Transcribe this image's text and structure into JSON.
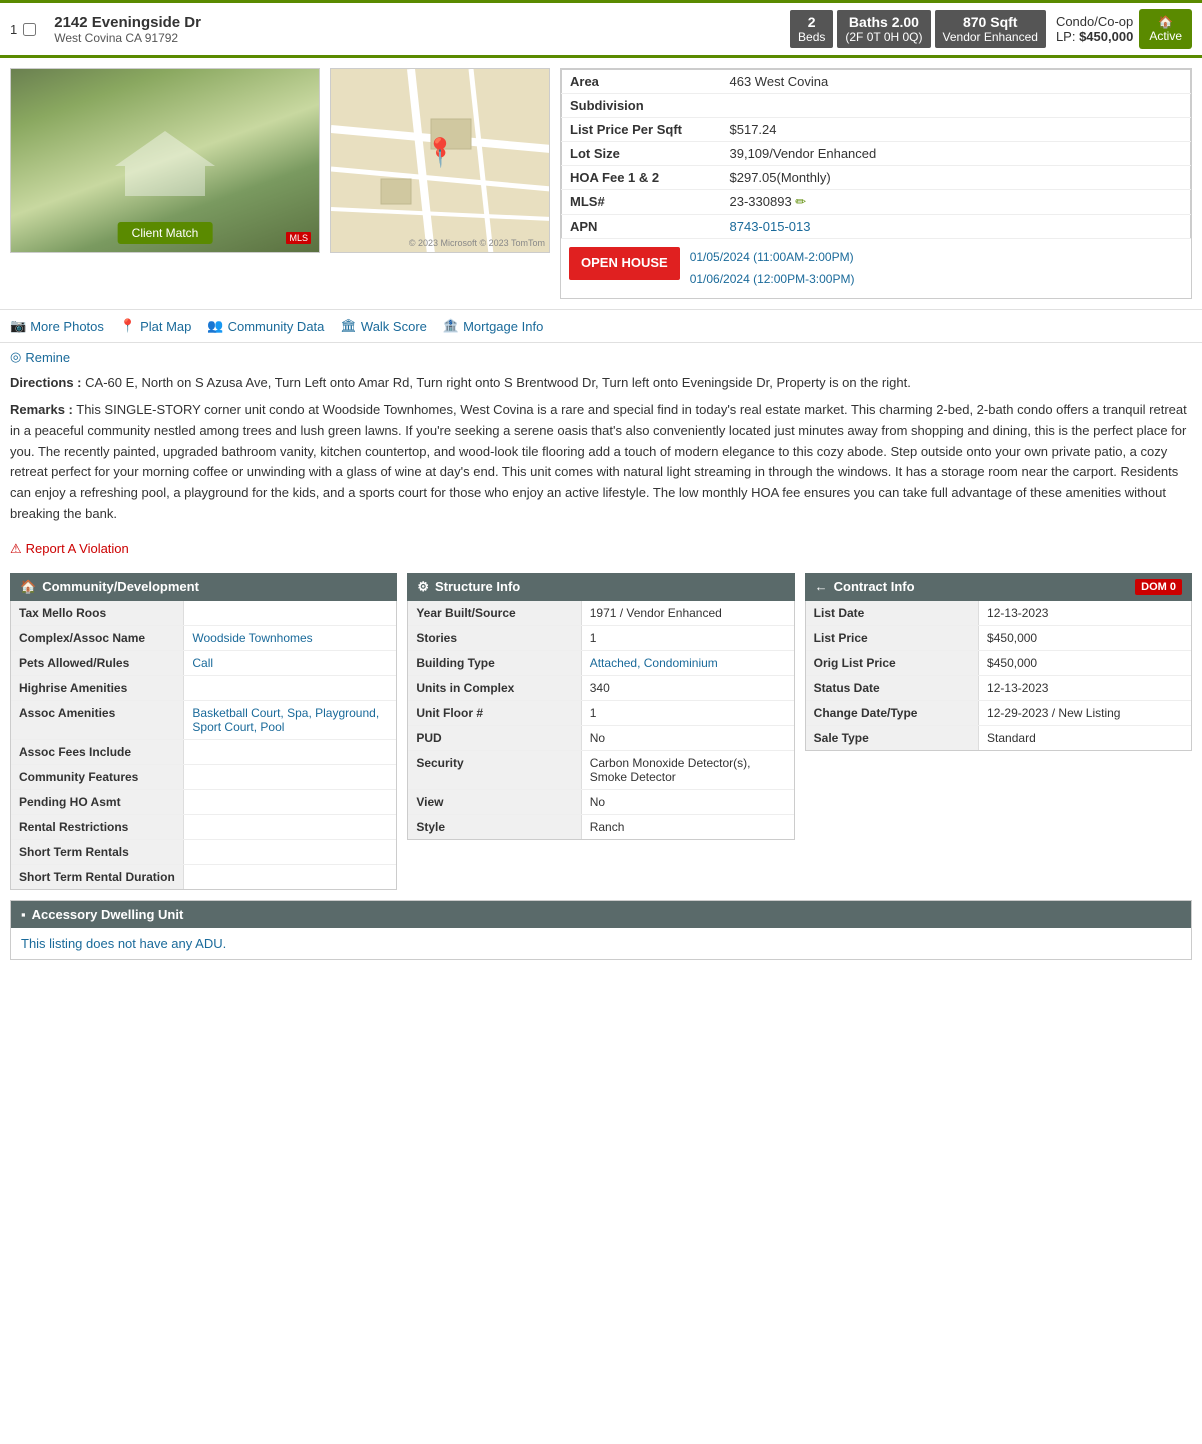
{
  "header": {
    "listing_number": "1",
    "checkbox_label": "1",
    "address_main": "2142 Eveningside Dr",
    "address_sub": "West Covina CA 91792",
    "beds_label": "Beds",
    "beds_count": "2",
    "baths_label": "Baths 2.00",
    "baths_detail": "(2F 0T 0H 0Q)",
    "sqft_label": "870 Sqft",
    "sqft_detail": "Vendor Enhanced",
    "property_type": "Condo/Co-op",
    "list_price_label": "LP:",
    "list_price": "$450,000",
    "active_label": "Active"
  },
  "details": {
    "area_label": "Area",
    "area_value": "463 West Covina",
    "subdivision_label": "Subdivision",
    "subdivision_value": "",
    "list_price_sqft_label": "List Price Per Sqft",
    "list_price_sqft_value": "$517.24",
    "lot_size_label": "Lot Size",
    "lot_size_value": "39,109/Vendor Enhanced",
    "hoa_label": "HOA Fee 1 & 2",
    "hoa_value": "$297.05(Monthly)",
    "mls_label": "MLS#",
    "mls_value": "23-330893",
    "apn_label": "APN",
    "apn_value": "8743-015-013"
  },
  "open_house": {
    "button_label": "OPEN HOUSE",
    "date1": "01/05/2024 (11:00AM-2:00PM)",
    "date2": "01/06/2024 (12:00PM-3:00PM)"
  },
  "action_links": {
    "more_photos": "More Photos",
    "plat_map": "Plat Map",
    "community_data": "Community Data",
    "walk_score": "Walk Score",
    "mortgage_info": "Mortgage Info",
    "remine": "Remine"
  },
  "description": {
    "directions_label": "Directions :",
    "directions_text": "CA-60 E, North on S Azusa Ave, Turn Left onto Amar Rd, Turn right onto S Brentwood Dr, Turn left onto Eveningside Dr, Property is on the right.",
    "remarks_label": "Remarks :",
    "remarks_text": "This SINGLE-STORY corner unit condo at Woodside Townhomes, West Covina is a rare and special find in today's real estate market. This charming 2-bed, 2-bath condo offers a tranquil retreat in a peaceful community nestled among trees and lush green lawns. If you're seeking a serene oasis that's also conveniently located just minutes away from shopping and dining, this is the perfect place for you. The recently painted, upgraded bathroom vanity, kitchen countertop, and wood-look tile flooring add a touch of modern elegance to this cozy abode. Step outside onto your own private patio, a cozy retreat perfect for your morning coffee or unwinding with a glass of wine at day's end. This unit comes with natural light streaming in through the windows. It has a storage room near the carport. Residents can enjoy a refreshing pool, a playground for the kids, and a sports court for those who enjoy an active lifestyle. The low monthly HOA fee ensures you can take full advantage of these amenities without breaking the bank.",
    "report_violation": "Report A Violation",
    "client_match": "Client Match"
  },
  "community_dev": {
    "header": "Community/Development",
    "rows": [
      {
        "label": "Tax Mello Roos",
        "value": ""
      },
      {
        "label": "Complex/Assoc Name",
        "value": "Woodside Townhomes"
      },
      {
        "label": "Pets Allowed/Rules",
        "value": "Call"
      },
      {
        "label": "Highrise Amenities",
        "value": ""
      },
      {
        "label": "Assoc Amenities",
        "value": "Basketball Court, Spa, Playground, Sport Court, Pool"
      },
      {
        "label": "Assoc Fees Include",
        "value": ""
      },
      {
        "label": "Community Features",
        "value": ""
      },
      {
        "label": "Pending HO Asmt",
        "value": ""
      },
      {
        "label": "Rental Restrictions",
        "value": ""
      },
      {
        "label": "Short Term Rentals",
        "value": ""
      },
      {
        "label": "Short Term Rental Duration",
        "value": ""
      }
    ]
  },
  "structure_info": {
    "header": "Structure Info",
    "rows": [
      {
        "label": "Year Built/Source",
        "value": "1971 / Vendor Enhanced"
      },
      {
        "label": "Stories",
        "value": "1"
      },
      {
        "label": "Building Type",
        "value": "Attached, Condominium"
      },
      {
        "label": "Units in Complex",
        "value": "340"
      },
      {
        "label": "Unit Floor #",
        "value": "1"
      },
      {
        "label": "PUD",
        "value": "No"
      },
      {
        "label": "Security",
        "value": "Carbon Monoxide Detector(s), Smoke Detector"
      },
      {
        "label": "View",
        "value": "No"
      },
      {
        "label": "Style",
        "value": "Ranch"
      }
    ]
  },
  "contract_info": {
    "header": "Contract Info",
    "dom_label": "DOM 0",
    "rows": [
      {
        "label": "List Date",
        "value": "12-13-2023"
      },
      {
        "label": "List Price",
        "value": "$450,000"
      },
      {
        "label": "Orig List Price",
        "value": "$450,000"
      },
      {
        "label": "Status Date",
        "value": "12-13-2023"
      },
      {
        "label": "Change Date/Type",
        "value": "12-29-2023 / New Listing"
      },
      {
        "label": "Sale Type",
        "value": "Standard"
      }
    ]
  },
  "adu": {
    "header": "Accessory Dwelling Unit",
    "body": "This listing does not have any ADU."
  }
}
